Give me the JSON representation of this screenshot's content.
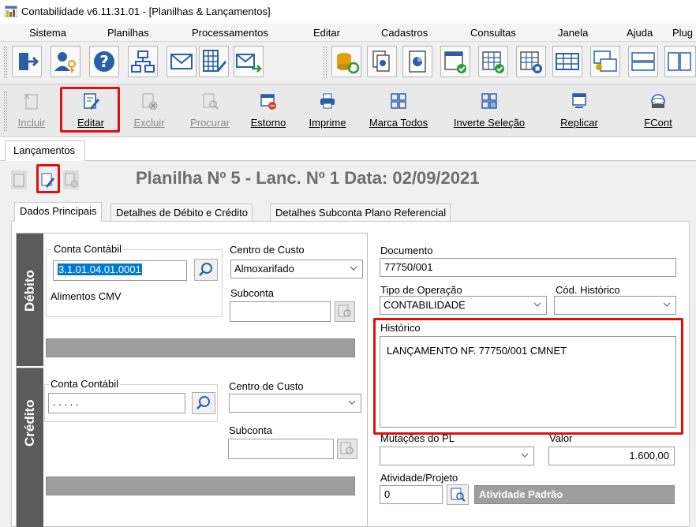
{
  "window": {
    "title": "Contabilidade v6.11.31.01 - [Planilhas & Lançamentos]"
  },
  "menu": [
    "Sistema",
    "Planilhas",
    "Processamentos",
    "Editar",
    "Cadastros",
    "Consultas",
    "Janela",
    "Ajuda",
    "Plug"
  ],
  "toolbar2": {
    "incluir": "Incluir",
    "editar": "Editar",
    "excluir": "Excluir",
    "procurar": "Procurar",
    "estorno": "Estorno",
    "imprime": "Imprime",
    "marca_todos": "Marca Todos",
    "inverte_selecao": "Inverte Seleção",
    "replicar": "Replicar",
    "fcont": "FCont"
  },
  "tab": {
    "label": "Lançamentos"
  },
  "header": {
    "title": "Planilha Nº 5 - Lanc. Nº 1 Data: 02/09/2021"
  },
  "subtabs": [
    "Dados Principais",
    "Detalhes de Débito e Crédito",
    "Detalhes Subconta Plano Referencial"
  ],
  "debito": {
    "side_label": "Débito",
    "conta_label": "Conta Contábil",
    "conta_value": "3.1.01.04.01.0001",
    "conta_desc": "Alimentos CMV",
    "centro_label": "Centro de Custo",
    "centro_value": "Almoxarifado",
    "subconta_label": "Subconta"
  },
  "credito": {
    "side_label": "Crédito",
    "conta_label": "Conta Contábil",
    "conta_value": ". . . . .",
    "centro_label": "Centro de Custo",
    "centro_value": "",
    "subconta_label": "Subconta"
  },
  "right": {
    "documento_label": "Documento",
    "documento_value": "77750/001",
    "tipo_label": "Tipo de Operação",
    "tipo_value": "CONTABILIDADE",
    "cod_label": "Cód. Histórico",
    "cod_value": "",
    "historico_label": "Histórico",
    "historico_value": "LANÇAMENTO NF. 77750/001 CMNET",
    "mutacoes_label": "Mutações do PL",
    "valor_label": "Valor",
    "valor_value": "1.600,00",
    "atividade_label": "Atividade/Projeto",
    "atividade_value": "0",
    "atividade_desc": "Atividade Padrão"
  },
  "colors": {
    "highlight": "#e01010",
    "selection": "#0078d7",
    "sidebar": "#5b5b5b",
    "title_gray": "#6e6e6e"
  }
}
